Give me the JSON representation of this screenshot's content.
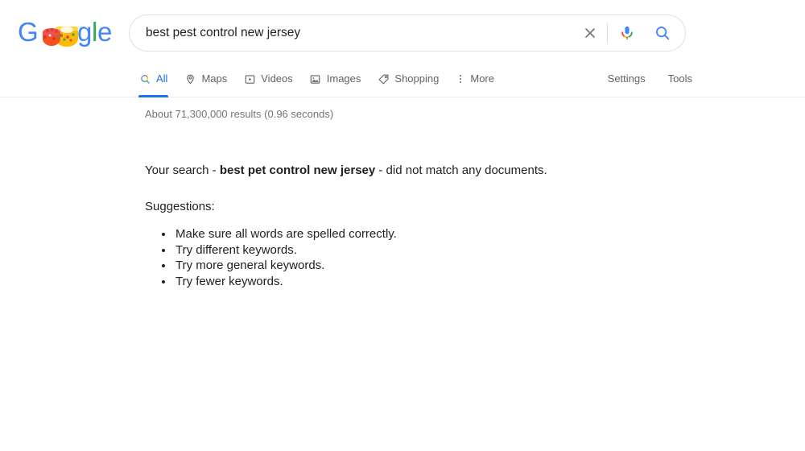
{
  "logo": {
    "alt": "Google Doodle logo",
    "letters": [
      {
        "ch": "G",
        "color": "#4285F4"
      },
      {
        "ch": "l",
        "color": "#34A853"
      },
      {
        "ch": "e",
        "color": "#4285F4"
      }
    ],
    "doodle_note": "two decorated cakes replacing the double-o"
  },
  "search": {
    "value": "best pest control new jersey",
    "placeholder": "Search Google or type a URL",
    "clear_icon": "close-icon",
    "mic_icon": "microphone-icon",
    "search_icon": "search-icon"
  },
  "nav": {
    "tabs": [
      {
        "label": "All",
        "icon": "search-icon",
        "active": true
      },
      {
        "label": "Maps",
        "icon": "map-pin-icon",
        "active": false
      },
      {
        "label": "Videos",
        "icon": "video-icon",
        "active": false
      },
      {
        "label": "Images",
        "icon": "image-icon",
        "active": false
      },
      {
        "label": "Shopping",
        "icon": "tag-icon",
        "active": false
      },
      {
        "label": "More",
        "icon": "more-vertical-icon",
        "active": false
      }
    ],
    "settings_label": "Settings",
    "tools_label": "Tools"
  },
  "results": {
    "stats": "About 71,300,000 results (0.96 seconds)",
    "no_match_prefix": "Your search - ",
    "no_match_query": "best pet control new jersey",
    "no_match_suffix": " - did not match any documents.",
    "suggestions_title": "Suggestions:",
    "suggestions": [
      "Make sure all words are spelled correctly.",
      "Try different keywords.",
      "Try more general keywords.",
      "Try fewer keywords."
    ]
  },
  "colors": {
    "google_blue": "#4285F4",
    "google_red": "#EA4335",
    "google_yellow": "#FBBC05",
    "google_green": "#34A853",
    "link_blue": "#1a73e8",
    "text_grey": "#5f6368",
    "stats_grey": "#70757a"
  }
}
